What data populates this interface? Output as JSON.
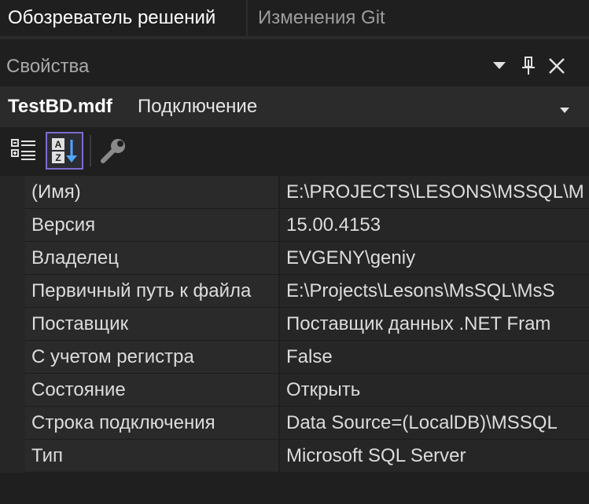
{
  "tabs": [
    {
      "label": "Обозреватель решений",
      "active": true
    },
    {
      "label": "Изменения Git",
      "active": false
    }
  ],
  "window": {
    "title": "Свойства",
    "buttons": [
      "dropdown-icon",
      "pin-icon",
      "close-icon"
    ]
  },
  "selector": {
    "object_name": "TestBD.mdf",
    "object_type": "Подключение"
  },
  "toolbar": {
    "buttons": [
      {
        "icon": "categorized-icon",
        "selected": false
      },
      {
        "icon": "alphabetical-sort-icon",
        "selected": true
      },
      {
        "icon": "property-pages-wrench-icon",
        "selected": false
      }
    ]
  },
  "properties": [
    {
      "name": "(Имя)",
      "value": "E:\\PROJECTS\\LESONS\\MSSQL\\M"
    },
    {
      "name": "Версия",
      "value": "15.00.4153"
    },
    {
      "name": "Владелец",
      "value": "EVGENY\\geniy"
    },
    {
      "name": "Первичный путь к файла",
      "value": "E:\\Projects\\Lesons\\MsSQL\\MsS"
    },
    {
      "name": "Поставщик",
      "value": "Поставщик данных .NET Fram"
    },
    {
      "name": "С учетом регистра",
      "value": "False"
    },
    {
      "name": "Состояние",
      "value": "Открыть"
    },
    {
      "name": "Строка подключения",
      "value": "Data Source=(LocalDB)\\MSSQL"
    },
    {
      "name": "Тип",
      "value": "Microsoft SQL Server"
    }
  ],
  "colors": {
    "background": "#1f1f1f",
    "selector_bg": "#2b2b2b",
    "accent_selected": "#7f6bd1",
    "sort_arrow": "#4fa6ff"
  }
}
